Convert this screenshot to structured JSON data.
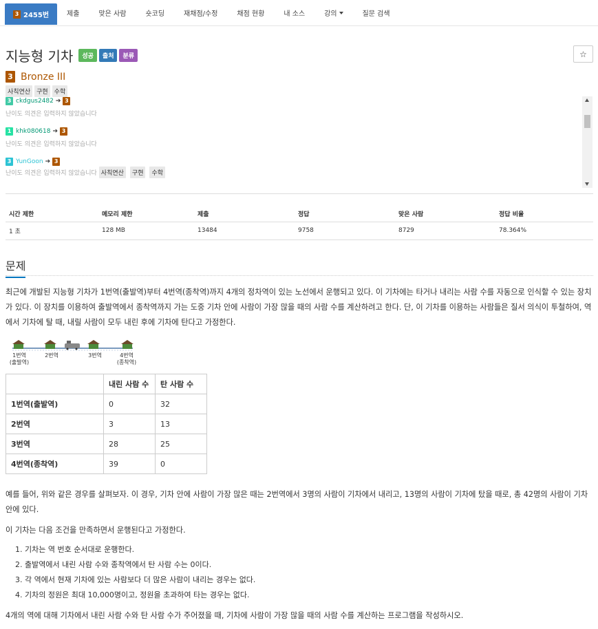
{
  "nav": {
    "tabs": [
      {
        "label": "2455번",
        "badge": "3"
      },
      {
        "label": "제출"
      },
      {
        "label": "맞은 사람"
      },
      {
        "label": "숏코딩"
      },
      {
        "label": "재채점/수정"
      },
      {
        "label": "채점 현황"
      },
      {
        "label": "내 소스"
      },
      {
        "label": "강의"
      },
      {
        "label": "질문 검색"
      }
    ]
  },
  "problem": {
    "title": "지능형 기차",
    "labels": [
      {
        "text": "성공",
        "color": "#5cb85c"
      },
      {
        "text": "출처",
        "color": "#337ab7"
      },
      {
        "text": "분류",
        "color": "#9b59b6"
      }
    ],
    "star": "☆",
    "tier_badge": "3",
    "tier_name": "Bronze III",
    "tags": [
      "사칙연산",
      "구현",
      "수학"
    ]
  },
  "opinions": [
    {
      "badge": "3",
      "user": "ckdgus2482",
      "arrow": "➔",
      "to_badge": "3",
      "msg": "난이도 의견은 입력하지 않았습니다",
      "tags": []
    },
    {
      "badge": "1",
      "user": "khk080618",
      "arrow": "➔",
      "to_badge": "3",
      "msg": "난이도 의견은 입력하지 않았습니다",
      "tags": []
    },
    {
      "badge": "3",
      "user": "YunGoon",
      "arrow": "➔",
      "to_badge": "3",
      "msg": "난이도 의견은 입력하지 않았습니다",
      "tags": [
        "사칙연산",
        "구현",
        "수학"
      ]
    }
  ],
  "stats": {
    "headers": [
      "시간 제한",
      "메모리 제한",
      "제출",
      "정답",
      "맞은 사람",
      "정답 비율"
    ],
    "values": [
      "1 초",
      "128 MB",
      "13484",
      "9758",
      "8729",
      "78.364%"
    ]
  },
  "section": {
    "problem_heading": "문제",
    "intro": "최근에 개발된 지능형 기차가 1번역(출발역)부터 4번역(종착역)까지 4개의 정차역이 있는 노선에서 운행되고 있다. 이 기차에는 타거나 내리는 사람 수를 자동으로 인식할 수 있는 장치가 있다. 이 장치를 이용하여 출발역에서 종착역까지 가는 도중 기차 안에 사람이 가장 많을 때의 사람 수를 계산하려고 한다. 단, 이 기차를 이용하는 사람들은 질서 의식이 투철하여, 역에서 기차에 탈 때, 내릴 사람이 모두 내린 후에 기차에 탄다고 가정한다.",
    "diagram_labels": [
      "1번역\n(출발역)",
      "2번역",
      "3번역",
      "4번역\n(종착역)"
    ],
    "table": {
      "headers": [
        "",
        "내린 사람 수",
        "탄 사람 수"
      ],
      "rows": [
        [
          "1번역(출발역)",
          "0",
          "32"
        ],
        [
          "2번역",
          "3",
          "13"
        ],
        [
          "3번역",
          "28",
          "25"
        ],
        [
          "4번역(종착역)",
          "39",
          "0"
        ]
      ]
    },
    "example": "예를 들어, 위와 같은 경우를 살펴보자. 이 경우, 기차 안에 사람이 가장 많은 때는 2번역에서 3명의 사람이 기차에서 내리고, 13명의 사람이 기차에 탔을 때로, 총 42명의 사람이 기차 안에 있다.",
    "conditions_intro": "이 기차는 다음 조건을 만족하면서 운행된다고 가정한다.",
    "conditions": [
      "1. 기차는 역 번호 순서대로 운행한다.",
      "2. 출발역에서 내린 사람 수와 종착역에서 탄 사람 수는 0이다.",
      "3. 각 역에서 현재 기차에 있는 사람보다 더 많은 사람이 내리는 경우는 없다.",
      "4. 기차의 정원은 최대 10,000명이고, 정원을 초과하여 타는 경우는 없다."
    ],
    "task": "4개의 역에 대해 기차에서 내린 사람 수와 탄 사람 수가 주어졌을 때, 기차에 사람이 가장 많을 때의 사람 수를 계산하는 프로그램을 작성하시오."
  }
}
